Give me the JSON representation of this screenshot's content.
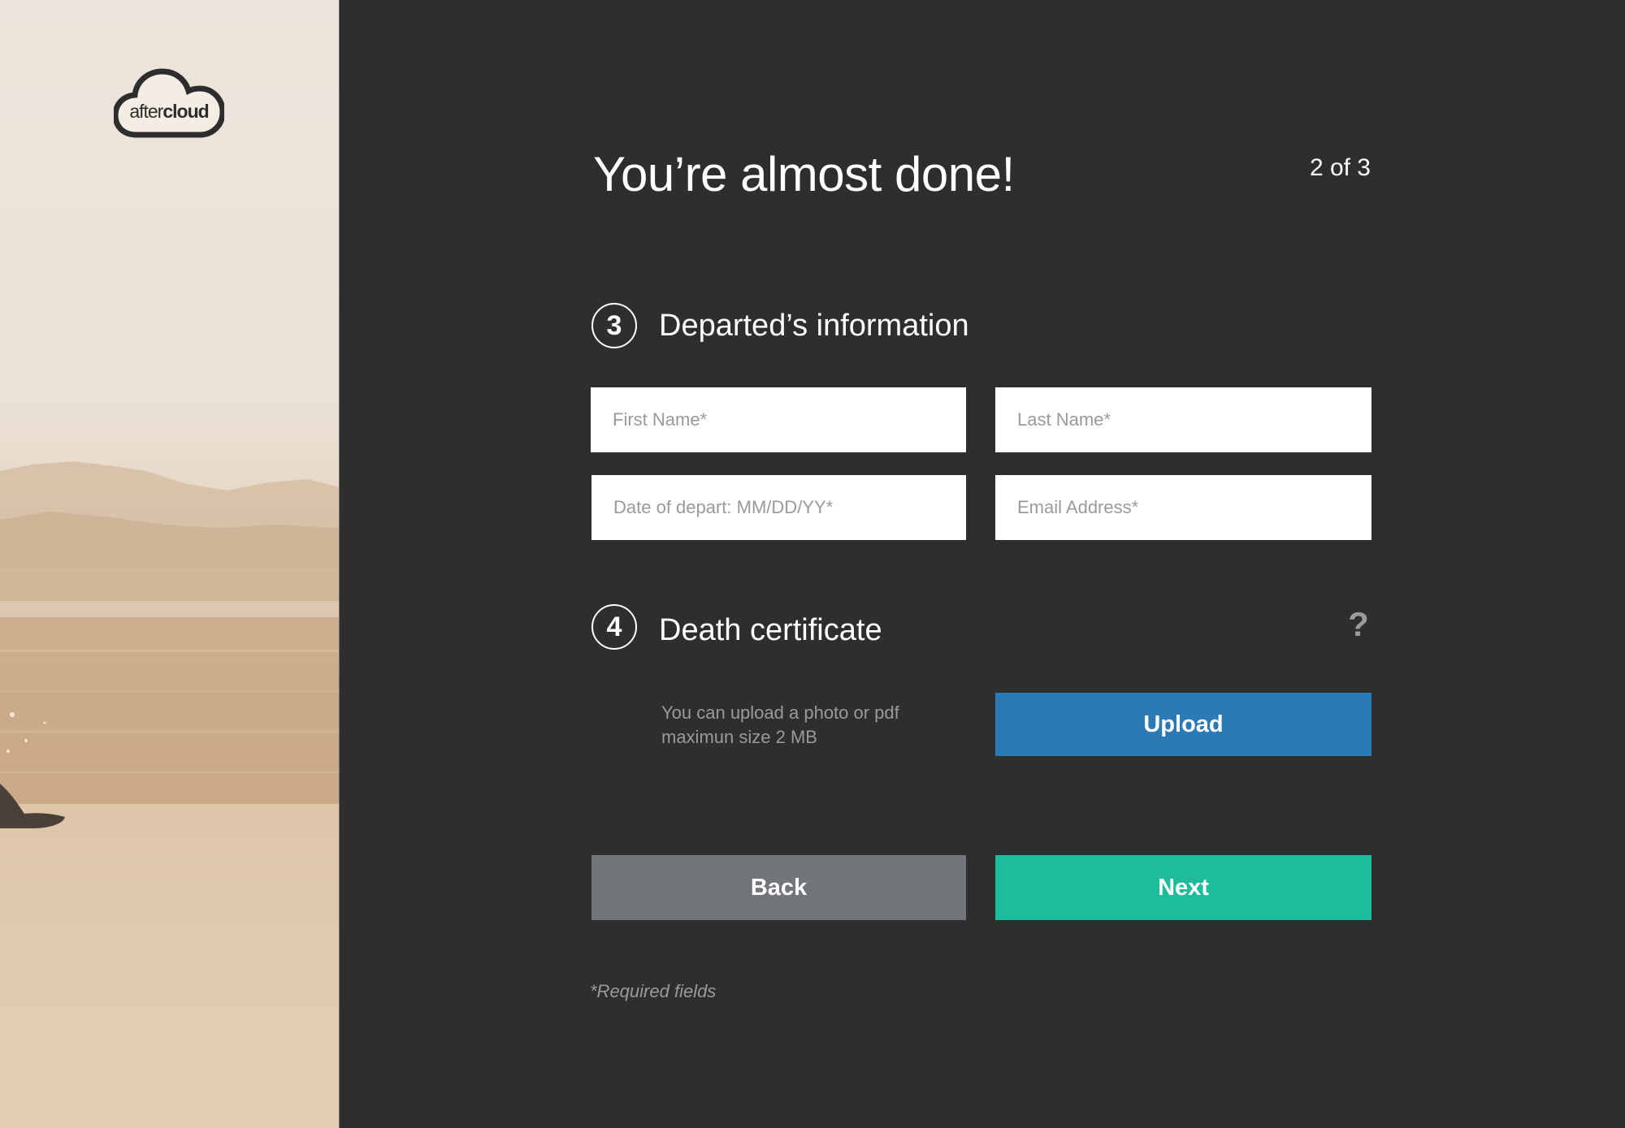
{
  "brand": {
    "logo_prefix": "after",
    "logo_suffix": "cloud",
    "logo_icon": "cloud-icon"
  },
  "header": {
    "title": "You’re almost done!",
    "step": "2 of 3"
  },
  "section_departed": {
    "number": "3",
    "title": "Departed’s information",
    "first_name_placeholder": "First Name*",
    "last_name_placeholder": "Last Name*",
    "date_placeholder": "Date of depart: MM/DD/YY*",
    "email_placeholder": "Email Address*"
  },
  "section_certificate": {
    "number": "4",
    "title": "Death certificate",
    "help_label": "?",
    "help_icon": "question-mark-icon",
    "note_line1": "You can upload a photo or pdf",
    "note_line2": "maximun size 2 MB",
    "upload_label": "Upload"
  },
  "actions": {
    "back_label": "Back",
    "next_label": "Next"
  },
  "footer": {
    "required_note": "*Required fields"
  },
  "colors": {
    "background": "#2e2e2e",
    "upload": "#2b79b5",
    "back": "#72767a",
    "next": "#1cbc9c",
    "placeholder": "#9a9a9a"
  }
}
